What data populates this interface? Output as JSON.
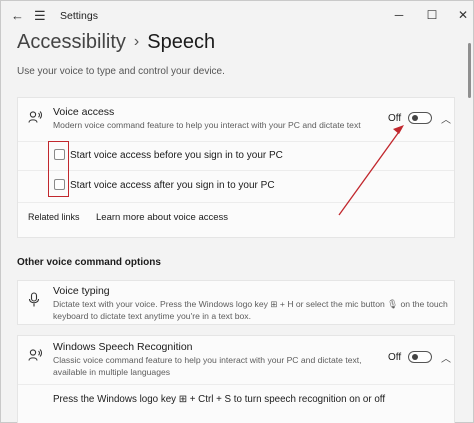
{
  "window": {
    "title": "Settings",
    "back_icon": "back-arrow-icon",
    "menu_icon": "hamburger-menu-icon",
    "controls": [
      "minimize",
      "maximize",
      "close"
    ]
  },
  "breadcrumb": {
    "parent": "Accessibility",
    "separator": "›",
    "current": "Speech"
  },
  "page": {
    "subtitle": "Use your voice to type and control your device."
  },
  "voice_access": {
    "title": "Voice access",
    "description": "Modern voice command feature to help you interact with your PC and dictate text",
    "toggle_label": "Off",
    "toggle_state": "off",
    "icon": "voice-access-icon",
    "expanded": true,
    "checkboxes": [
      {
        "label": "Start voice access before you sign in to your PC",
        "checked": false
      },
      {
        "label": "Start voice access after you sign in to your PC",
        "checked": false
      }
    ],
    "related_links_label": "Related links",
    "related_link": "Learn more about voice access"
  },
  "other_section": {
    "heading": "Other voice command options"
  },
  "voice_typing": {
    "title": "Voice typing",
    "description_line1": "Dictate text with your voice. Press the Windows logo key ⊞ + H or select the mic button 🎙 on the touch",
    "description_line2": "keyboard to dictate text anytime you're in a text box.",
    "icon": "microphone-icon"
  },
  "speech_recognition": {
    "title": "Windows Speech Recognition",
    "description_line1": "Classic voice command feature to help you interact with your PC and dictate text,",
    "description_line2": "available in multiple languages",
    "toggle_label": "Off",
    "toggle_state": "off",
    "icon": "speech-recognition-icon",
    "shortcut_text": "Press the Windows logo key ⊞ + Ctrl + S to turn speech recognition on or off"
  },
  "colors": {
    "background": "#f3f3f3",
    "card": "#fbfbfb",
    "annotation_red": "#c1272d"
  }
}
